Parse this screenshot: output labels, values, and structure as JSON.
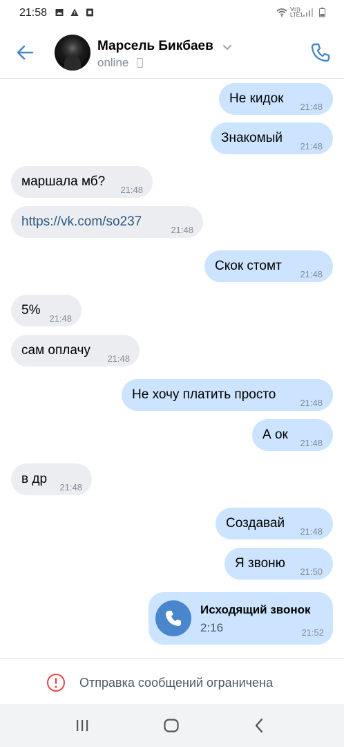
{
  "status_bar": {
    "time": "21:58",
    "network_label_top": "Vo))",
    "network_label_bottom": "LTE1",
    "icons": [
      "image-icon",
      "warning-icon",
      "sim-icon",
      "wifi-icon",
      "signal-icon",
      "battery-icon"
    ]
  },
  "header": {
    "contact_name": "Марсель Бикбаев",
    "status": "online",
    "icons": [
      "back-arrow-icon",
      "chevron-down-icon",
      "phone-icon"
    ]
  },
  "messages": [
    {
      "dir": "out",
      "text": "Не кидок",
      "time": "21:48"
    },
    {
      "dir": "out",
      "text": "Знакомый",
      "time": "21:48"
    },
    {
      "dir": "in",
      "text": "маршала мб?",
      "time": "21:48"
    },
    {
      "dir": "in",
      "text": "https://vk.com/so237",
      "time": "21:48",
      "link": true
    },
    {
      "dir": "out",
      "text": "Скок стомт",
      "time": "21:48"
    },
    {
      "dir": "in",
      "text": "5%",
      "time": "21:48"
    },
    {
      "dir": "in",
      "text": "сам оплачу",
      "time": "21:48"
    },
    {
      "dir": "out",
      "text": "Не хочу платить просто",
      "time": "21:48"
    },
    {
      "dir": "out",
      "text": "А ок",
      "time": "21:48"
    },
    {
      "dir": "in",
      "text": "в др",
      "time": "21:48"
    },
    {
      "dir": "out",
      "text": "Создавай",
      "time": "21:48"
    },
    {
      "dir": "out",
      "text": "Я звоню",
      "time": "21:50"
    }
  ],
  "call": {
    "title": "Исходящий звонок",
    "duration": "2:16",
    "time": "21:52"
  },
  "restriction": {
    "text": "Отправка сообщений ограничена"
  },
  "navbar": {
    "icons": [
      "recent-apps-icon",
      "home-icon",
      "back-icon"
    ]
  },
  "colors": {
    "accent": "#4986cc",
    "outgoing_bubble": "#cce4ff",
    "incoming_bubble": "#ebedf0",
    "link": "#2a5885",
    "warning": "#e64646",
    "secondary_text": "#818c99"
  }
}
